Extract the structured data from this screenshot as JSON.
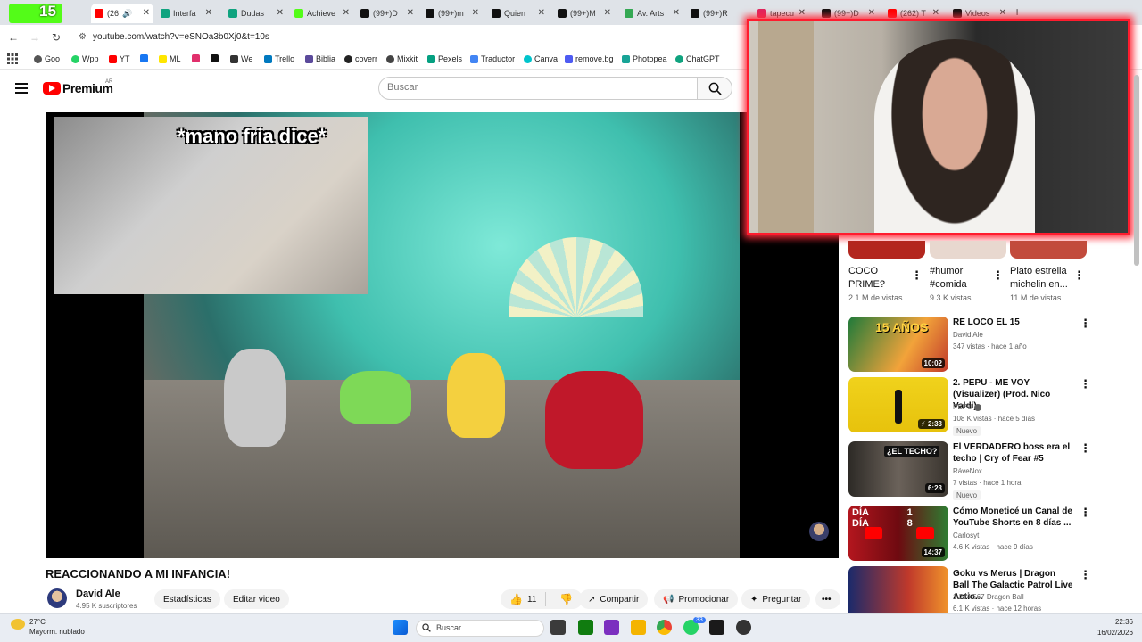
{
  "browser": {
    "tabs": [
      {
        "label": "",
        "icon": "kick-icon",
        "color": "#53fc18"
      },
      {
        "label": "(26",
        "icon": "youtube-icon",
        "color": "#ff0000",
        "active": true
      },
      {
        "label": "Interfa",
        "icon": "chatgpt-icon",
        "color": "#10a37f"
      },
      {
        "label": "Dudas",
        "icon": "chatgpt-icon",
        "color": "#10a37f"
      },
      {
        "label": "Achieve",
        "icon": "kick-icon",
        "color": "#53fc18"
      },
      {
        "label": "(99+)D",
        "icon": "tiktok-icon",
        "color": "#111111"
      },
      {
        "label": "(99+)m",
        "icon": "tiktok-icon",
        "color": "#111111"
      },
      {
        "label": "Quien",
        "icon": "tiktok-icon",
        "color": "#111111"
      },
      {
        "label": "(99+)M",
        "icon": "tiktok-icon",
        "color": "#111111"
      },
      {
        "label": "Av. Arts",
        "icon": "maps-icon",
        "color": "#34a853"
      },
      {
        "label": "(99+)R",
        "icon": "tiktok-icon",
        "color": "#111111"
      },
      {
        "label": "tapecu",
        "icon": "record-icon",
        "color": "#e0245e"
      },
      {
        "label": "(99+)D",
        "icon": "tiktok-icon",
        "color": "#111111"
      },
      {
        "label": "(262) T",
        "icon": "youtube-icon",
        "color": "#ff0000"
      },
      {
        "label": "Videos",
        "icon": "tiktok-icon",
        "color": "#111111"
      }
    ],
    "stream_badge": "15",
    "url": "youtube.com/watch?v=eSNOa3b0Xj0&t=10s",
    "bookmarks": [
      {
        "label": "Goo",
        "color": "#555555"
      },
      {
        "label": "Wpp",
        "color": "#25d366"
      },
      {
        "label": "YT",
        "color": "#ff0000"
      },
      {
        "label": "",
        "color": "#1877f2"
      },
      {
        "label": "ML",
        "color": "#ffe600"
      },
      {
        "label": "",
        "color": "#e1306c"
      },
      {
        "label": "",
        "color": "#111111"
      },
      {
        "label": "We",
        "color": "#333333"
      },
      {
        "label": "Trello",
        "color": "#0079bf"
      },
      {
        "label": "Biblia",
        "color": "#5b4a9b"
      },
      {
        "label": "coverr",
        "color": "#222222"
      },
      {
        "label": "Mixkit",
        "color": "#444444"
      },
      {
        "label": "Pexels",
        "color": "#05a081"
      },
      {
        "label": "Traductor",
        "color": "#4285f4"
      },
      {
        "label": "Canva",
        "color": "#00c4cc"
      },
      {
        "label": "remove.bg",
        "color": "#4e5bf2"
      },
      {
        "label": "Photopea",
        "color": "#18a497"
      },
      {
        "label": "ChatGPT",
        "color": "#10a37f"
      }
    ]
  },
  "youtube": {
    "brand": "Premium",
    "country": "AR",
    "search_placeholder": "Buscar",
    "overlay_caption": "*mano fria dice*",
    "video_title": "REACCIONANDO A MI INFANCIA!",
    "channel_name": "David Ale",
    "subscribers": "4.95 K suscriptores",
    "buttons": {
      "stats": "Estadísticas",
      "edit": "Editar video",
      "likes": "11",
      "share": "Compartir",
      "promote": "Promocionar",
      "ask": "Preguntar"
    },
    "shorts": [
      {
        "title": "COCO PRIME?",
        "views": "2.1 M de vistas"
      },
      {
        "title": "#humor #comida",
        "views": "9.3 K vistas"
      },
      {
        "title": "Plato estrella michelin en...",
        "views": "11 M de vistas"
      }
    ],
    "recommendations": [
      {
        "title": "RE LOCO EL 15",
        "channel": "David Ale",
        "meta": "347 vistas · hace 1 año",
        "duration": "10:02",
        "badge": "",
        "thumb_text": "15 AÑOS"
      },
      {
        "title": "2. PEPU - ME VOY (Visualizer) (Prod. Nico Valdi)",
        "channel": "PEPU",
        "meta": "108 K vistas · hace 5 días",
        "duration": "2:33",
        "badge": "Nuevo",
        "thumb_text": ""
      },
      {
        "title": "El VERDADERO boss era el techo | Cry of Fear #5",
        "channel": "RáveNox",
        "meta": "7 vistas · hace 1 hora",
        "duration": "6:23",
        "badge": "Nuevo",
        "thumb_text": "¿EL TECHO?"
      },
      {
        "title": "Cómo Moneticé un Canal de YouTube Shorts en 8 días ...",
        "channel": "Carlosyt",
        "meta": "4.6 K vistas · hace 9 días",
        "duration": "14:37",
        "badge": "",
        "thumb_text": "DÍA 1 DÍA 8"
      },
      {
        "title": "Goku vs Merus | Dragon Ball The Galactic Patrol Live Actio...",
        "channel": "1.234.567 Dragon Ball",
        "meta": "6.1 K vistas · hace 12 horas",
        "duration": "",
        "badge": "",
        "thumb_text": ""
      }
    ]
  },
  "taskbar": {
    "temperature": "27°C",
    "weather": "Mayorm. nublado",
    "search": "Buscar",
    "notif_badge": "33",
    "time": "22:36",
    "date": "16/02/2026"
  }
}
